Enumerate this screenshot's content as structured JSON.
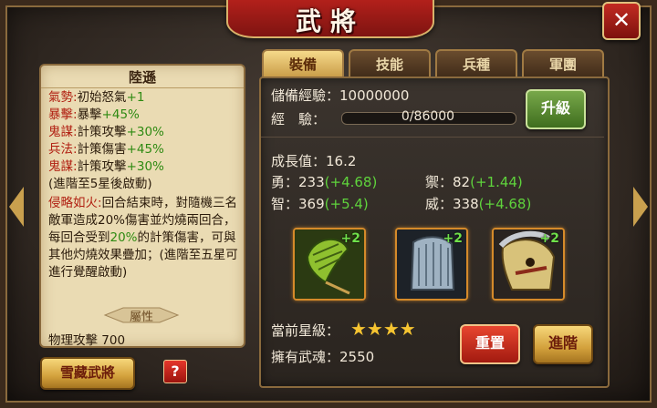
{
  "title": "武將",
  "close_label": "✕",
  "hero": {
    "name": "陸遜",
    "skills": [
      {
        "label": "氣勢:",
        "value": "初始怒氣",
        "bonus": "+1"
      },
      {
        "label": "暴擊:",
        "value": "暴擊",
        "bonus": "+45%"
      },
      {
        "label": "鬼謀:",
        "value": "計策攻擊",
        "bonus": "+30%"
      },
      {
        "label": "兵法:",
        "value": "計策傷害",
        "bonus": "+45%"
      },
      {
        "label": "鬼謀:",
        "value": "計策攻擊",
        "bonus": "+30%"
      }
    ],
    "skill_note": "(進階至5星後啟動)",
    "ability_name": "侵略如火:",
    "ability_text_1": "回合結束時，對隨機三名敵軍造成20%傷害並灼燒兩回合，每回合受到",
    "ability_pct": "20%",
    "ability_text_2": "的計策傷害，可與其他灼燒效果疊加；(進階至五星可進行覺醒啟動)",
    "attr_header": "屬性",
    "phys_label": "物理攻擊",
    "phys_value": "700"
  },
  "buttons": {
    "hide_general": "雪藏武將",
    "help": "?",
    "upgrade": "升級",
    "reset": "重置",
    "advance": "進階"
  },
  "tabs": [
    {
      "label": "裝備",
      "active": true
    },
    {
      "label": "技能",
      "active": false
    },
    {
      "label": "兵種",
      "active": false
    },
    {
      "label": "軍團",
      "active": false
    }
  ],
  "stats": {
    "reserve_exp_label": "儲備經驗：",
    "reserve_exp_value": "10000000",
    "exp_label": "經　驗：",
    "exp_value": "0/86000",
    "exp_fraction": 0,
    "growth_label": "成長值：",
    "growth_value": "16.2",
    "brave_label": "勇：",
    "brave_value": "233",
    "brave_bonus": "(+4.68)",
    "guard_label": "禦：",
    "guard_value": "82",
    "guard_bonus": "(+1.44)",
    "wis_label": "智：",
    "wis_value": "369",
    "wis_bonus": "(+5.4)",
    "might_label": "威：",
    "might_value": "338",
    "might_bonus": "(+4.68)"
  },
  "equipment": [
    {
      "icon": "fan-icon",
      "plus": "+2"
    },
    {
      "icon": "armor-icon",
      "plus": "+2"
    },
    {
      "icon": "horse-icon",
      "plus": "+2"
    }
  ],
  "star_level_label": "當前星級：",
  "stars": 4,
  "star_glyphs": "★★★★",
  "soul_label": "擁有武魂：",
  "soul_value": "2550"
}
